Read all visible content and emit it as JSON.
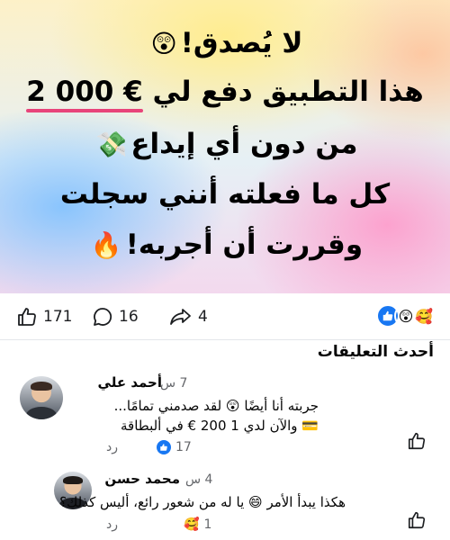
{
  "post": {
    "hero_lines": [
      "لا يُصدق!",
      "هذا التطبيق دفع لي",
      "من دون أي إيداع",
      "كل ما فعلته أنني سجلت",
      "وقررت أن أجربه!"
    ],
    "hero_amount": "2 000 €",
    "hero_emojis": [
      "😲",
      "💸",
      "🔥"
    ],
    "accent_underline": "#e8447a"
  },
  "reaction_bar": {
    "likes_count": "171",
    "comments_count": "16",
    "shares_count": "4",
    "reaction_emojis": [
      "😲",
      "🥰"
    ]
  },
  "comments": {
    "heading": "أحدث التعليقات",
    "reply_label": "رد",
    "items": [
      {
        "author": "أحمد علي",
        "time": "7 س",
        "text_line1": "جربته أنا أيضًا 😲 لقد صدمني تمامًا...",
        "text_line2": "💳 والآن لدي 1 200 € في ألبطاقة",
        "reaction_count": "17"
      },
      {
        "author": "محمد حسن",
        "time": "4 س",
        "text_line1": "هكذا يبدأ الأمر 😄 يا له من شعور رائع، أليس كذلك؟",
        "reaction_emoji": "🥰",
        "reaction_count": "1"
      }
    ]
  },
  "colors": {
    "facebook_blue": "#1877f2",
    "secondary_text": "#65676b"
  }
}
